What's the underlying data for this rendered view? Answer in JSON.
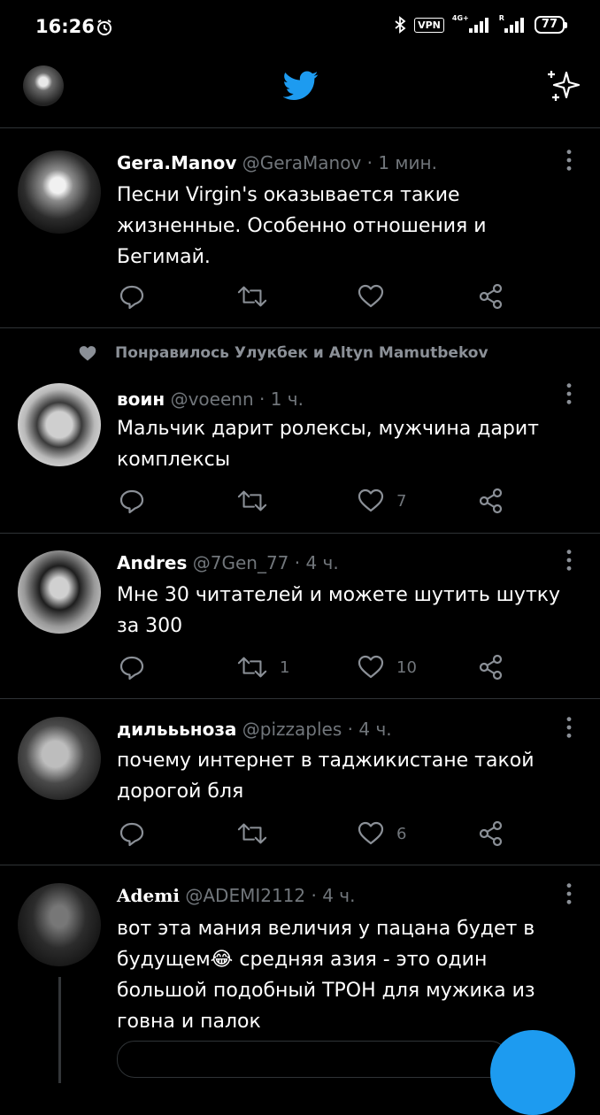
{
  "status_bar": {
    "time": "16:26",
    "vpn": "VPN",
    "network1": "4G+",
    "network2": "R",
    "battery": "77"
  },
  "header": {
    "logo": "twitter-bird-icon",
    "accent": "#1d9bf0"
  },
  "tweets": [
    {
      "name": "Gera.Manov",
      "handle": "@GeraManov",
      "time": "· 1 мин.",
      "text": "Песни Virgin's оказывается такие жизненные. Особенно отношения и Бегимай.",
      "likes": "",
      "retweets": ""
    },
    {
      "liked_by": "Понравилось Улукбек и Altyn Mamutbekov",
      "name": "воин",
      "handle": "@voeenn",
      "time": "· 1 ч.",
      "text": "Мальчик дарит ролексы, мужчина дарит комплексы",
      "likes": "7",
      "retweets": ""
    },
    {
      "name": "Andres",
      "handle": "@7Gen_77",
      "time": "· 4 ч.",
      "text": "Мне 30 читателей  и можете шутить шутку за 300",
      "likes": "10",
      "retweets": "1"
    },
    {
      "name": "дильььноза",
      "handle": "@pizzaples",
      "time": "· 4 ч.",
      "text": "почему интернет в таджикистане такой дорогой бля",
      "likes": "6",
      "retweets": ""
    },
    {
      "name": "Ademi",
      "handle": "@ADEMI2112",
      "time": "· 4 ч.",
      "text": "вот эта мания величия у пацана будет в будущем😂 средняя азия - это один большой подобный ТРОН для мужика из говна и палок",
      "likes": "",
      "retweets": ""
    }
  ]
}
